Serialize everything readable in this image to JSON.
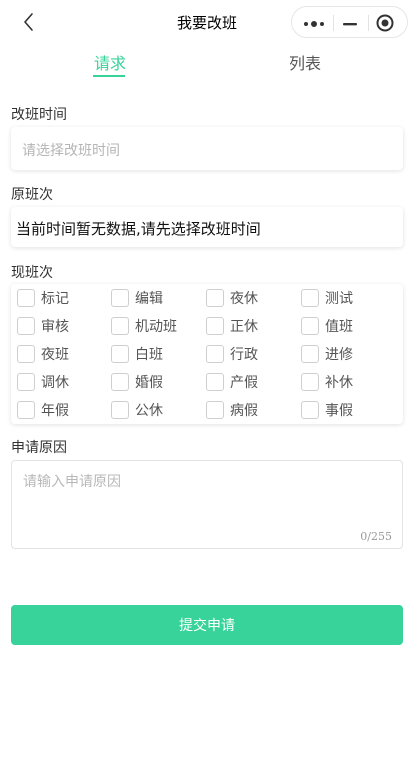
{
  "nav": {
    "title": "我要改班"
  },
  "tabs": {
    "request": "请求",
    "list": "列表"
  },
  "form": {
    "shift_time_label": "改班时间",
    "shift_time_placeholder": "请选择改班时间",
    "original_label": "原班次",
    "original_value": "当前时间暂无数据,请先选择改班时间",
    "current_label": "现班次",
    "shift_options": [
      "标记",
      "编辑",
      "夜休",
      "测试",
      "审核",
      "机动班",
      "正休",
      "值班",
      "夜班",
      "白班",
      "行政",
      "进修",
      "调休",
      "婚假",
      "产假",
      "补休",
      "年假",
      "公休",
      "病假",
      "事假"
    ],
    "reason_label": "申请原因",
    "reason_placeholder": "请输入申请原因",
    "reason_counter": "0/255",
    "submit_label": "提交申请"
  },
  "colors": {
    "accent": "#37d39a",
    "placeholder": "#b5b5b5",
    "text": "#333333"
  }
}
